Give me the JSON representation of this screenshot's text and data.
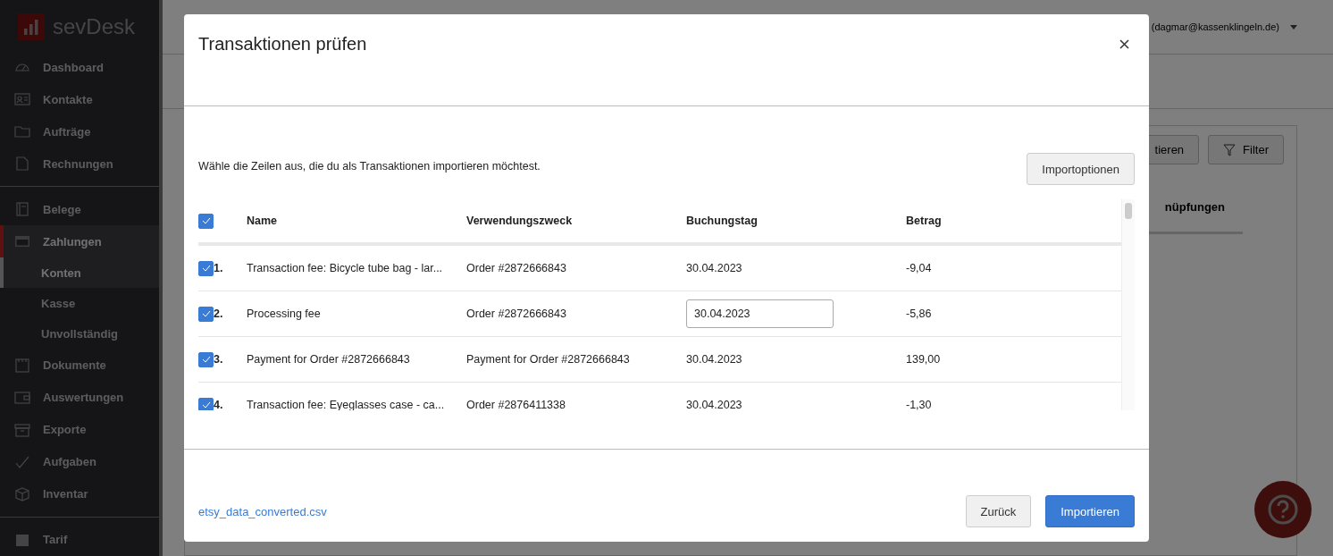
{
  "app": {
    "logo": "sevDesk",
    "user": "(dagmar@kassenklingeln.de)"
  },
  "sidebar": {
    "groups": [
      [
        {
          "label": "Dashboard",
          "selected": false
        },
        {
          "label": "Kontakte",
          "selected": false
        },
        {
          "label": "Aufträge",
          "selected": false
        },
        {
          "label": "Rechnungen",
          "selected": false
        }
      ],
      [
        {
          "label": "Belege",
          "selected": false
        },
        {
          "label": "Zahlungen",
          "selected": true,
          "children": [
            {
              "label": "Konten",
              "selected": true
            },
            {
              "label": "Kasse",
              "selected": false
            },
            {
              "label": "Unvollständig",
              "selected": false
            }
          ]
        },
        {
          "label": "Dokumente",
          "selected": false
        },
        {
          "label": "Auswertungen",
          "selected": false
        },
        {
          "label": "Exporte",
          "selected": false
        },
        {
          "label": "Aufgaben",
          "selected": false
        },
        {
          "label": "Inventar",
          "selected": false
        }
      ],
      [
        {
          "label": "Tarif",
          "selected": false
        }
      ]
    ]
  },
  "background": {
    "buttons": [
      "tieren",
      "Filter"
    ],
    "column_header": "nüpfungen"
  },
  "dialog": {
    "title": "Transaktionen prüfen",
    "instruction": "Wähle die Zeilen aus, die du als Transaktionen importieren möchtest.",
    "options_button": "Importoptionen",
    "table": {
      "all_checked": true,
      "columns": [
        "Name",
        "Verwendungszweck",
        "Buchungstag",
        "Betrag"
      ],
      "rows": [
        {
          "checked": true,
          "number": "1.",
          "name": "Transaction fee: Bicycle tube bag - lar...",
          "purpose": "Order #2872666843",
          "date": "30.04.2023",
          "date_editing": false,
          "amount": "-9,04"
        },
        {
          "checked": true,
          "number": "2.",
          "name": "Processing fee",
          "purpose": "Order #2872666843",
          "date": "30.04.2023",
          "date_editing": true,
          "amount": "-5,86"
        },
        {
          "checked": true,
          "number": "3.",
          "name": "Payment for Order #2872666843",
          "purpose": "Payment for Order #2872666843",
          "date": "30.04.2023",
          "date_editing": false,
          "amount": "139,00"
        },
        {
          "checked": true,
          "number": "4.",
          "name": "Transaction fee: Eyeglasses case - ca...",
          "purpose": "Order #2876411338",
          "date": "30.04.2023",
          "date_editing": false,
          "amount": "-1,30"
        }
      ]
    },
    "file_link": "etsy_data_converted.csv",
    "buttons": [
      {
        "label": "Zurück",
        "kind": "secondary"
      },
      {
        "label": "Importieren",
        "kind": "primary"
      }
    ]
  }
}
